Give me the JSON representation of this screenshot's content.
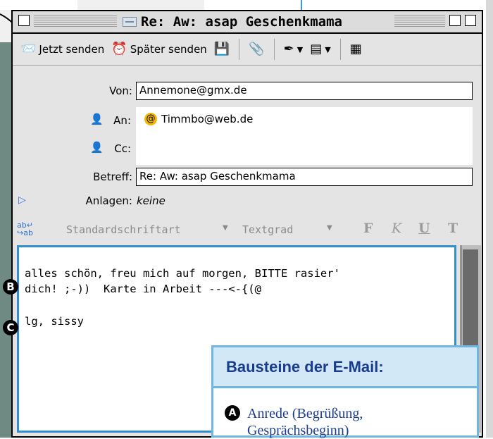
{
  "window": {
    "title": "Re: Aw: asap Geschenkmama"
  },
  "toolbar": {
    "send_now": "Jetzt senden",
    "send_later": "Später senden"
  },
  "header": {
    "from_label": "Von:",
    "from_value": "Annemone@gmx.de",
    "to_label": "An:",
    "to_value": "Timmbo@web.de",
    "cc_label": "Cc:",
    "subject_label": "Betreff:",
    "subject_value": "Re: Aw: asap Geschenkmama",
    "attachments_label": "Anlagen:",
    "attachments_value": "keine"
  },
  "format": {
    "font_select": "Standardschriftart",
    "size_select": "Textgrad",
    "bold": "F",
    "italic": "K",
    "underline": "U",
    "text": "T"
  },
  "body": {
    "line1": "alles schön, freu mich auf morgen, BITTE rasier'",
    "line2": "dich! ;-))  Karte in Arbeit ---<-{(@",
    "line3": "lg, sissy"
  },
  "markers": {
    "b": "B",
    "c": "C",
    "a": "A"
  },
  "infobox": {
    "title": "Bausteine der E-Mail:",
    "item_a": "Anrede (Begrüßung, Gesprächsbeginn)"
  },
  "colors": {
    "accent": "#2f8fd0",
    "info_text": "#1a3c8e",
    "info_head_bg": "#d3e8f6"
  }
}
